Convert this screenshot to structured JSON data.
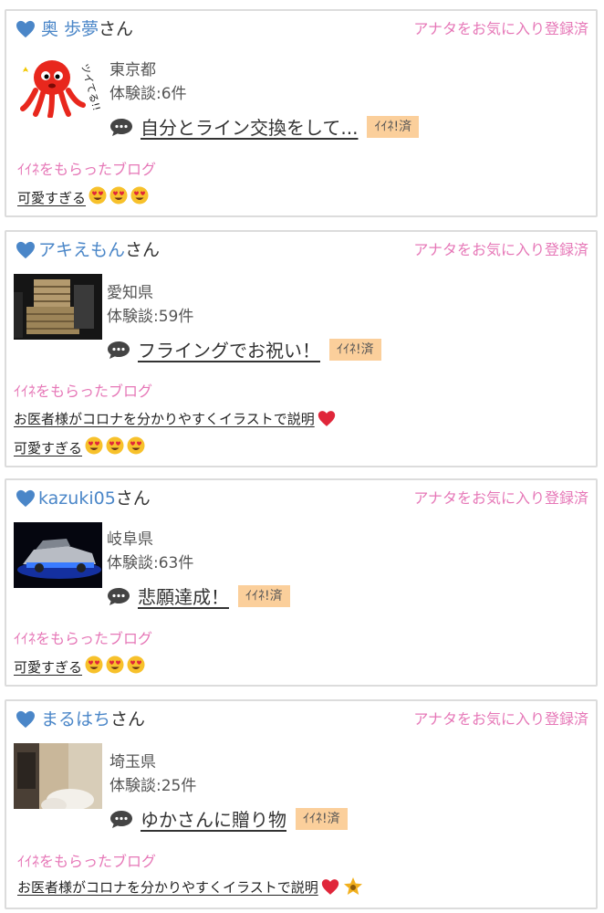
{
  "common": {
    "san_suffix": "さん",
    "favorite_label": "アナタをお気に入り登録済",
    "iine_label": "ｲｲﾈ!済",
    "received_blogs_title": "ｲｲﾈをもらったブログ"
  },
  "users": [
    {
      "name": "奥 歩夢",
      "prefecture": "東京都",
      "experience_count": "体験談:6件",
      "blog_title": "自分とライン交換をして...",
      "avatar_text": "ツイてる!!",
      "received_blogs": [
        {
          "title": "可愛すぎる",
          "emojis": 3,
          "star": false
        }
      ]
    },
    {
      "name": "アキえもん",
      "prefecture": "愛知県",
      "experience_count": "体験談:59件",
      "blog_title": "フライングでお祝い！",
      "received_blogs": [
        {
          "title": "お医者様がコロナを分かりやすくイラストで説明",
          "emojis": 0,
          "heart": true,
          "star": false
        },
        {
          "title": "可愛すぎる",
          "emojis": 3,
          "star": false
        }
      ]
    },
    {
      "name": "kazuki05",
      "prefecture": "岐阜県",
      "experience_count": "体験談:63件",
      "blog_title": "悲願達成！",
      "received_blogs": [
        {
          "title": "可愛すぎる",
          "emojis": 3,
          "star": false
        }
      ]
    },
    {
      "name": "まるはち",
      "prefecture": "埼玉県",
      "experience_count": "体験談:25件",
      "blog_title": "ゆかさんに贈り物",
      "received_blogs": [
        {
          "title": "お医者様がコロナを分かりやすくイラストで説明",
          "emojis": 0,
          "heart": true,
          "star": true
        }
      ]
    }
  ],
  "colors": {
    "username": "#4a86c8",
    "pink": "#e677b7",
    "iine_bg": "#fbcf9b",
    "border": "#dcdcdc"
  }
}
